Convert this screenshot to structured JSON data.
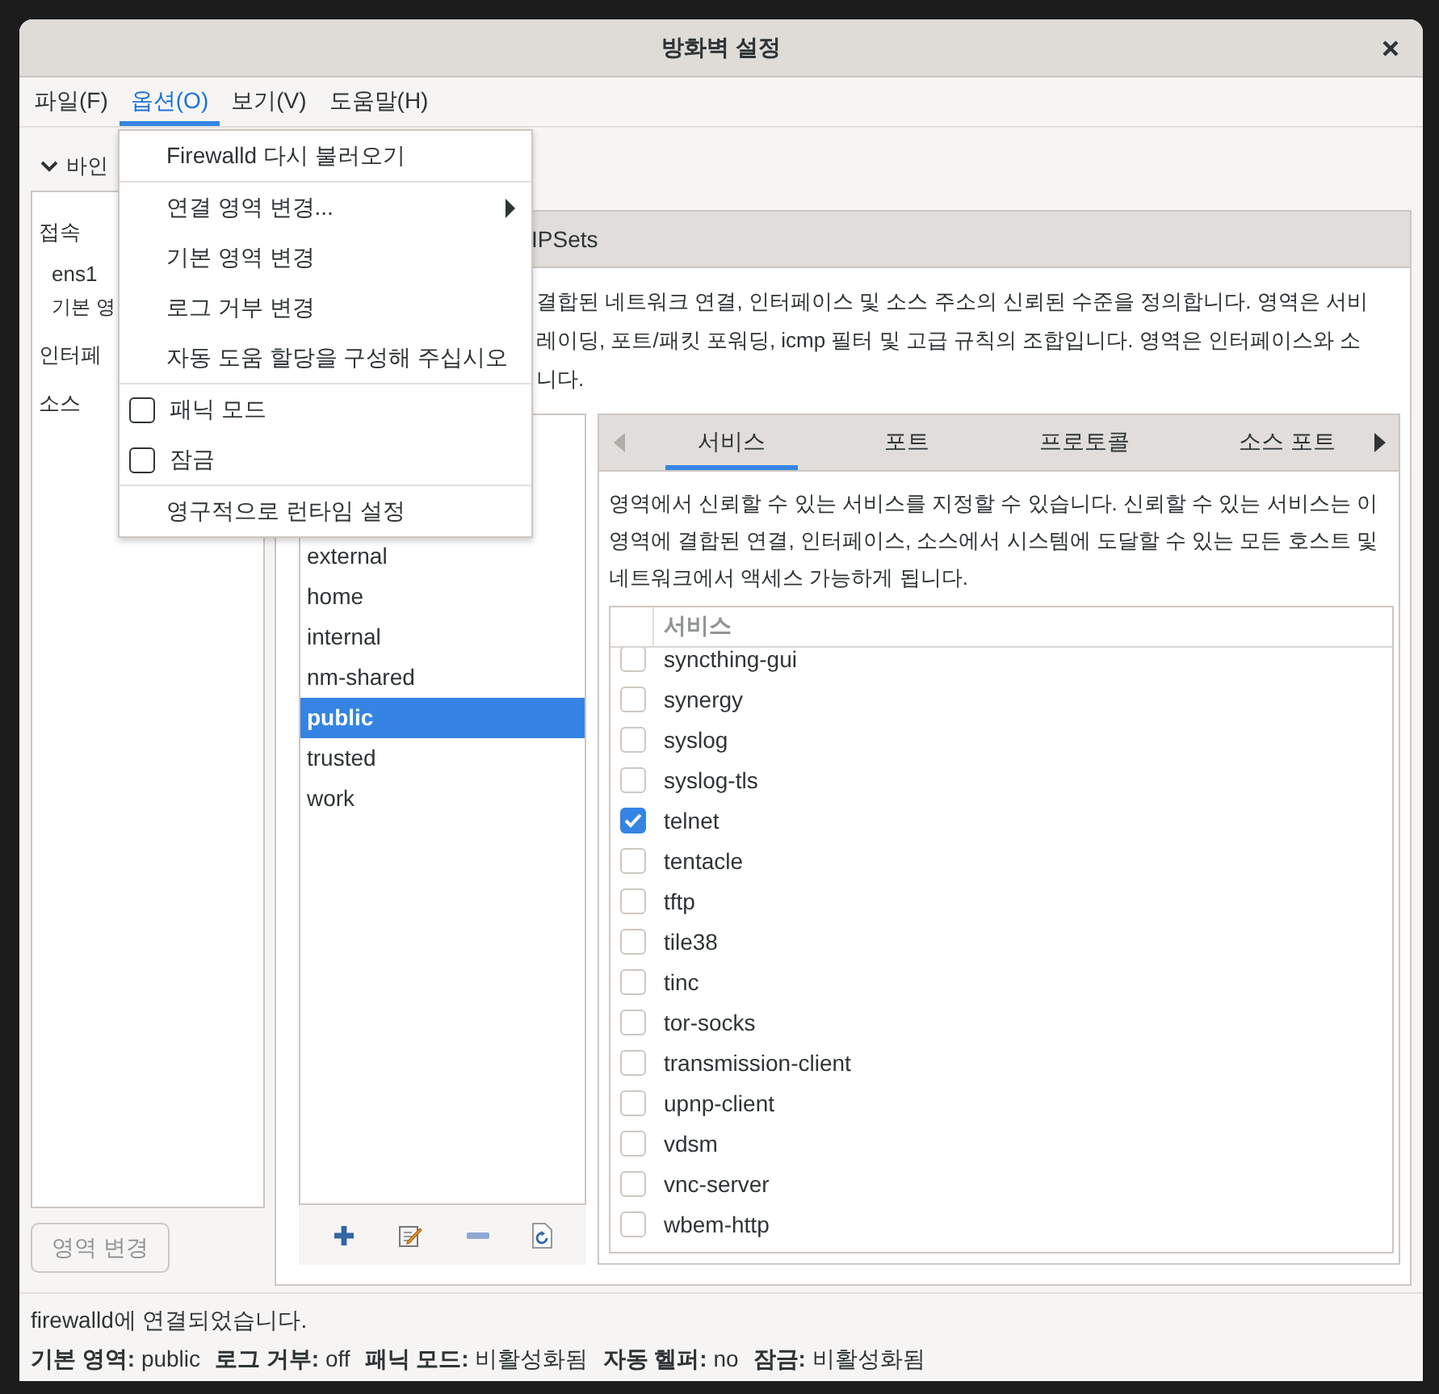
{
  "window": {
    "title": "방화벽 설정"
  },
  "menubar": [
    {
      "label": "파일(F)",
      "selected": false
    },
    {
      "label": "옵션(O)",
      "selected": true
    },
    {
      "label": "보기(V)",
      "selected": false
    },
    {
      "label": "도움말(H)",
      "selected": false
    }
  ],
  "open_menu": {
    "items": [
      {
        "kind": "action",
        "label": "Firewalld 다시 불러오기"
      },
      {
        "kind": "separator"
      },
      {
        "kind": "submenu",
        "label": "연결 영역 변경..."
      },
      {
        "kind": "action",
        "label": "기본 영역 변경"
      },
      {
        "kind": "action",
        "label": "로그 거부 변경"
      },
      {
        "kind": "action",
        "label": "자동 도움 할당을 구성해 주십시오"
      },
      {
        "kind": "separator"
      },
      {
        "kind": "check",
        "label": "패닉 모드",
        "checked": false
      },
      {
        "kind": "check",
        "label": "잠금",
        "checked": false
      },
      {
        "kind": "separator"
      },
      {
        "kind": "action",
        "label": "영구적으로 런타임 설정"
      }
    ]
  },
  "binding_expander": {
    "label": "바인",
    "expanded": true
  },
  "bindings": [
    {
      "kind": "header",
      "label": "접속"
    },
    {
      "kind": "entry",
      "label": "ens1"
    },
    {
      "kind": "detail",
      "label": "기본 영"
    },
    {
      "kind": "header",
      "label": "인터페"
    },
    {
      "kind": "header",
      "label": "소스"
    }
  ],
  "change_zone_button": {
    "label": "영역 변경",
    "disabled": true
  },
  "config_tabs": [
    {
      "label": "IPSets",
      "selected": false
    }
  ],
  "zone_description": [
    "결합된 네트워크 연결, 인터페이스 및 소스 주소의 신뢰된 수준을 정의합니다. 영역은 서비",
    "레이딩, 포트/패킷 포워딩, icmp 필터 및 고급 규칙의 조합입니다. 영역은 인터페이스와 소",
    "니다."
  ],
  "zones": [
    {
      "name": "external",
      "selected": false
    },
    {
      "name": "home",
      "selected": false
    },
    {
      "name": "internal",
      "selected": false
    },
    {
      "name": "nm-shared",
      "selected": false
    },
    {
      "name": "public",
      "selected": true
    },
    {
      "name": "trusted",
      "selected": false
    },
    {
      "name": "work",
      "selected": false
    }
  ],
  "zone_tabs": [
    {
      "label": "서비스",
      "selected": true
    },
    {
      "label": "포트",
      "selected": false
    },
    {
      "label": "프로토콜",
      "selected": false
    },
    {
      "label": "소스 포트",
      "selected": false
    }
  ],
  "services_description": [
    "영역에서 신뢰할 수 있는 서비스를 지정할 수 있습니다. 신뢰할 수 있는 서비스는 이",
    "영역에 결합된 연결, 인터페이스, 소스에서 시스템에 도달할 수 있는 모든 호스트 및",
    "네트워크에서 액세스 가능하게 됩니다."
  ],
  "services": {
    "column": "서비스",
    "rows": [
      {
        "name": "syncthing-gui",
        "checked": false
      },
      {
        "name": "synergy",
        "checked": false
      },
      {
        "name": "syslog",
        "checked": false
      },
      {
        "name": "syslog-tls",
        "checked": false
      },
      {
        "name": "telnet",
        "checked": true
      },
      {
        "name": "tentacle",
        "checked": false
      },
      {
        "name": "tftp",
        "checked": false
      },
      {
        "name": "tile38",
        "checked": false
      },
      {
        "name": "tinc",
        "checked": false
      },
      {
        "name": "tor-socks",
        "checked": false
      },
      {
        "name": "transmission-client",
        "checked": false
      },
      {
        "name": "upnp-client",
        "checked": false
      },
      {
        "name": "vdsm",
        "checked": false
      },
      {
        "name": "vnc-server",
        "checked": false
      },
      {
        "name": "wbem-http",
        "checked": false
      }
    ]
  },
  "status": {
    "message": "firewalld에 연결되었습니다.",
    "fields": [
      {
        "label": "기본 영역:",
        "value": "public"
      },
      {
        "label": "로그 거부:",
        "value": "off"
      },
      {
        "label": "패닉 모드:",
        "value": "비활성화됨"
      },
      {
        "label": "자동 헬퍼:",
        "value": "no"
      },
      {
        "label": "잠금:",
        "value": "비활성화됨"
      }
    ]
  }
}
